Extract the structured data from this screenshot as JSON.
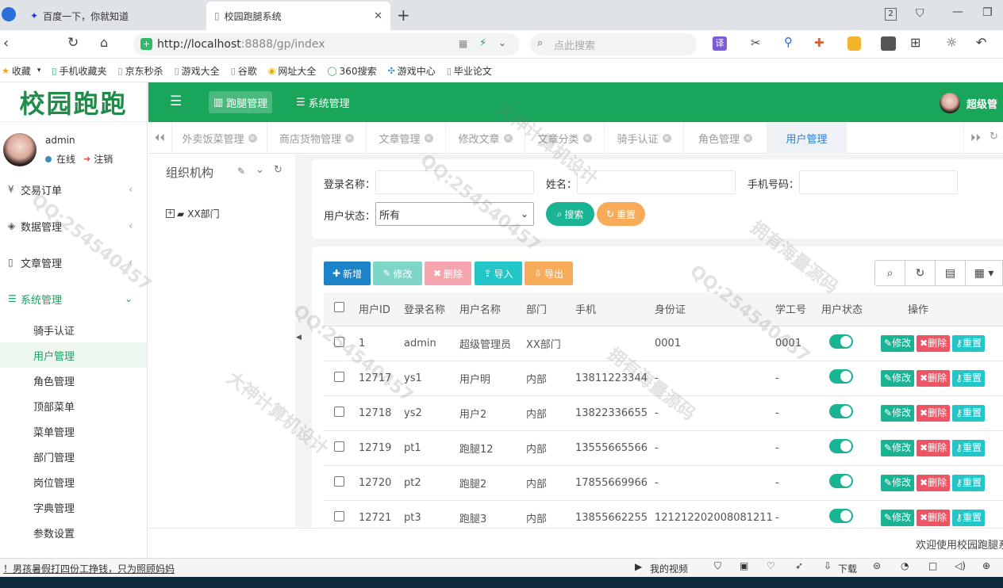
{
  "browser": {
    "tabs": [
      {
        "title": "百度一下，你就知道"
      },
      {
        "title": "校园跑腿系统"
      }
    ],
    "url_host": "http://localhost",
    "url_rest": ":8888/gp/index",
    "search_placeholder": "点此搜索",
    "bookmarks": [
      "收藏",
      "手机收藏夹",
      "京东秒杀",
      "游戏大全",
      "谷歌",
      "网址大全",
      "360搜索",
      "游戏中心",
      "毕业论文"
    ]
  },
  "app": {
    "logo": "校园跑跑",
    "user": {
      "name": "admin",
      "status": "在线",
      "logout": "注销"
    },
    "top_menu": {
      "errand": "跑腿管理",
      "system": "系统管理"
    },
    "top_user": "超级管",
    "sidebar": [
      {
        "label": "交易订单"
      },
      {
        "label": "数据管理"
      },
      {
        "label": "文章管理"
      },
      {
        "label": "系统管理"
      }
    ],
    "submenu": [
      "骑手认证",
      "用户管理",
      "角色管理",
      "顶部菜单",
      "菜单管理",
      "部门管理",
      "岗位管理",
      "字典管理",
      "参数设置"
    ],
    "page_tabs": [
      "外卖饭菜管理",
      "商店货物管理",
      "文章管理",
      "修改文章",
      "文章分类",
      "骑手认证",
      "角色管理",
      "用户管理"
    ],
    "org": {
      "title": "组织机构",
      "node": "XX部门"
    },
    "filter": {
      "login_label": "登录名称：",
      "name_label": "姓名：",
      "phone_label": "手机号码：",
      "status_label": "用户状态：",
      "status_value": "所有",
      "search": "搜索",
      "reset": "重置"
    },
    "toolbar": {
      "add": "新增",
      "edit": "修改",
      "delete": "删除",
      "import": "导入",
      "export": "导出"
    },
    "table": {
      "headers": [
        "用户ID",
        "登录名称",
        "用户名称",
        "部门",
        "手机",
        "身份证",
        "学工号",
        "用户状态",
        "操作"
      ],
      "row_actions": {
        "edit": "修改",
        "delete": "删除",
        "reset": "重置"
      },
      "rows": [
        {
          "id": "1",
          "login": "admin",
          "name": "超级管理员",
          "dept": "XX部门",
          "phone": "",
          "idcard": "0001",
          "sno": "0001"
        },
        {
          "id": "12717",
          "login": "ys1",
          "name": "用户明",
          "dept": "内部",
          "phone": "13811223344",
          "idcard": "-",
          "sno": "-"
        },
        {
          "id": "12718",
          "login": "ys2",
          "name": "用户2",
          "dept": "内部",
          "phone": "13822336655",
          "idcard": "-",
          "sno": "-"
        },
        {
          "id": "12719",
          "login": "pt1",
          "name": "跑腿12",
          "dept": "内部",
          "phone": "13555665566",
          "idcard": "-",
          "sno": "-"
        },
        {
          "id": "12720",
          "login": "pt2",
          "name": "跑腿2",
          "dept": "内部",
          "phone": "17855669966",
          "idcard": "-",
          "sno": "-"
        },
        {
          "id": "12721",
          "login": "pt3",
          "name": "跑腿3",
          "dept": "内部",
          "phone": "13855662255",
          "idcard": "121212202008081211",
          "sno": "-"
        }
      ]
    },
    "footer": "欢迎使用校园跑腿系"
  },
  "statusbar": {
    "news": "！男孩暑假打四份工挣钱，只为照顾妈妈",
    "video": "我的视频",
    "download": "下载"
  },
  "watermarks": [
    "QQ:254540457",
    "大神计算机设计",
    "拥有海量源码"
  ],
  "colors": {
    "brand": "#19a55a",
    "primary": "#1c84c6",
    "teal": "#1ab394",
    "danger": "#ed5565",
    "warning": "#f8ac59",
    "info": "#23c6c8"
  }
}
